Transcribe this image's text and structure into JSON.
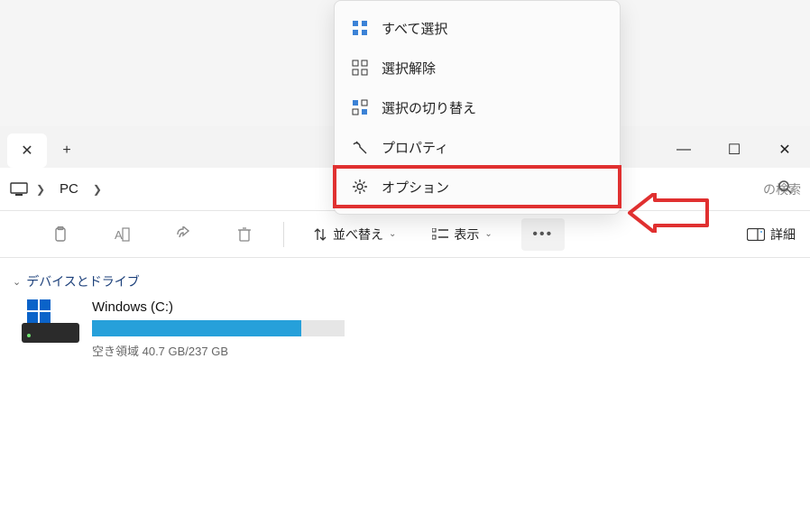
{
  "window": {
    "minimize_glyph": "—",
    "maximize_glyph": "☐",
    "close_glyph": "✕"
  },
  "tabbar": {
    "close_glyph": "✕",
    "add_glyph": "+"
  },
  "breadcrumbs": {
    "root_label": "PC"
  },
  "search": {
    "visible_text": "の検索"
  },
  "toolbar": {
    "sort_label": "並べ替え",
    "view_label": "表示",
    "details_label": "詳細"
  },
  "content": {
    "section_header": "デバイスとドライブ",
    "drives": [
      {
        "name": "Windows (C:)",
        "free_text": "空き領域 40.7 GB/237 GB",
        "free_gb": 40.7,
        "total_gb": 237,
        "fill_percent": 83
      }
    ]
  },
  "menu": {
    "items": [
      {
        "label": "すべて選択",
        "icon": "select-all-icon"
      },
      {
        "label": "選択解除",
        "icon": "select-none-icon"
      },
      {
        "label": "選択の切り替え",
        "icon": "invert-selection-icon"
      },
      {
        "label": "プロパティ",
        "icon": "properties-icon"
      },
      {
        "label": "オプション",
        "icon": "options-icon",
        "highlighted": true
      }
    ]
  }
}
